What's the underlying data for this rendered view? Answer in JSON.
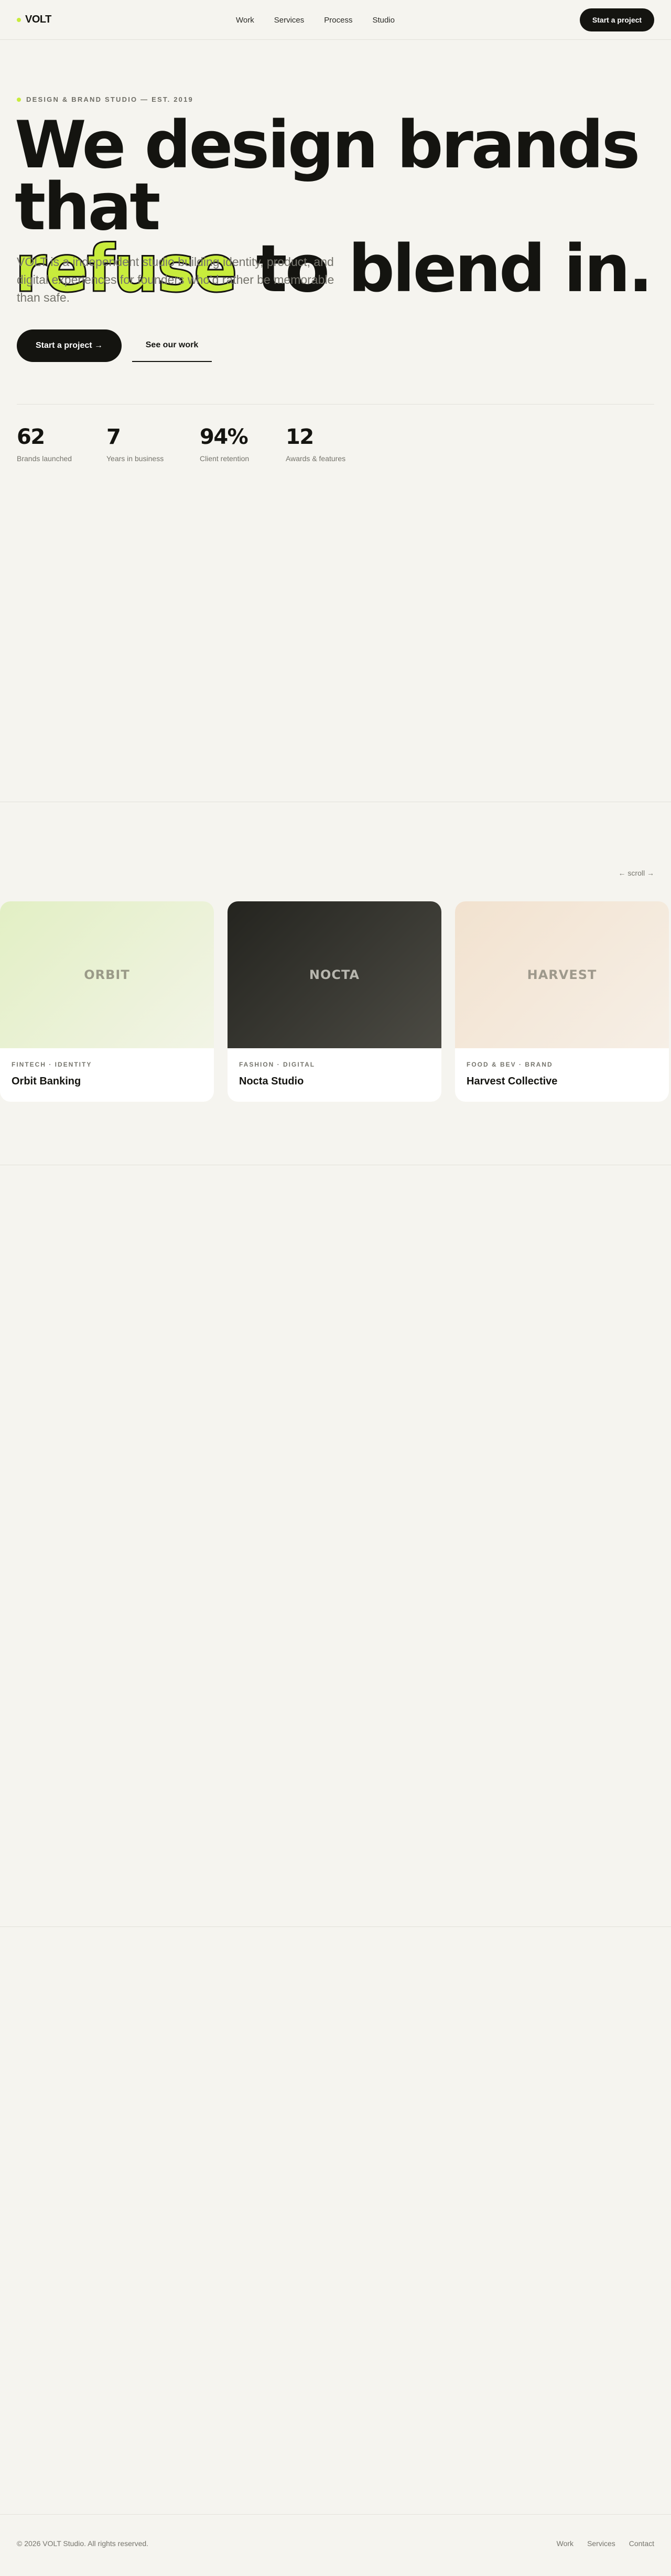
{
  "nav": {
    "logo": "VOLT",
    "links": [
      "Work",
      "Services",
      "Process",
      "Studio"
    ],
    "cta": "Start a project"
  },
  "hero": {
    "eyebrow": "DESIGN & BRAND STUDIO — EST. 2019",
    "headline_line1": "We design brands that",
    "headline_highlight": "refuse",
    "headline_line2_rest": " to blend in.",
    "lead": "VOLT is a independent studio building identity, product, and digital experiences for founders who'd rather be memorable than safe.",
    "primary_cta": "Start a project →",
    "secondary_cta": "See our work"
  },
  "stats": [
    {
      "value": "62",
      "label": "Brands launched"
    },
    {
      "value": "7",
      "label": "Years in business"
    },
    {
      "value": "94%",
      "label": "Client retention"
    },
    {
      "value": "12",
      "label": "Awards & features"
    }
  ],
  "work": {
    "scroll_hint": "← scroll →",
    "cards": [
      {
        "thumb_label": "ORBIT",
        "tag": "FINTECH · IDENTITY",
        "name": "Orbit Banking"
      },
      {
        "thumb_label": "NOCTA",
        "tag": "FASHION · DIGITAL",
        "name": "Nocta Studio"
      },
      {
        "thumb_label": "HARVEST",
        "tag": "FOOD & BEV · BRAND",
        "name": "Harvest Collective"
      }
    ]
  },
  "footer": {
    "copyright": "© 2026 VOLT Studio. All rights reserved.",
    "links": [
      "Work",
      "Services",
      "Contact"
    ]
  },
  "colors": {
    "background": "#f5f4ef",
    "accent": "#c8ec3c",
    "ink": "#141410",
    "muted": "#75746c"
  }
}
